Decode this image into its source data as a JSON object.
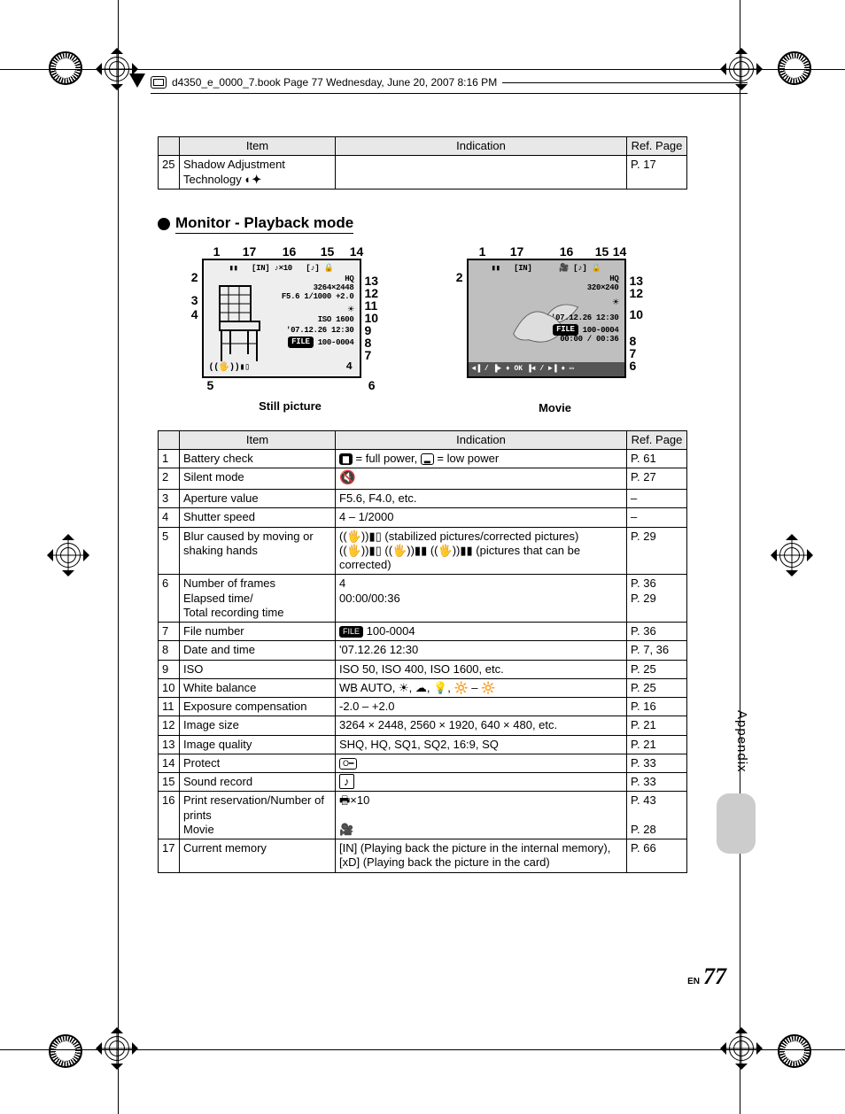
{
  "header_line": "d4350_e_0000_7.book  Page 77  Wednesday, June 20, 2007  8:16 PM",
  "top_table": {
    "headers": [
      "",
      "Item",
      "Indication",
      "Ref. Page"
    ],
    "row": {
      "num": "25",
      "item": "Shadow Adjustment Technology",
      "indication_icon": "shadow-adj-icon",
      "ref": "P. 17"
    }
  },
  "heading": "Monitor - Playback mode",
  "diagram_left": {
    "top_numbers": [
      "1",
      "17",
      "16",
      "15",
      "14"
    ],
    "left_numbers": [
      "2",
      "3",
      "4"
    ],
    "right_numbers": [
      "13",
      "12",
      "11",
      "10",
      "9",
      "8",
      "7"
    ],
    "bottom_numbers": [
      "5",
      "6"
    ],
    "screen_lines": {
      "l1": "[IN] ♪×10",
      "l2": "HQ",
      "l3": "3264×2448",
      "l4": "F5.6 1/1000 +2.0",
      "l5": "☀",
      "l6": "ISO 1600",
      "l7": "'07.12.26 12:30",
      "l8": "FILE 100-0004",
      "l9": "4"
    },
    "label": "Still picture"
  },
  "diagram_right": {
    "top_numbers": [
      "1",
      "17",
      "16",
      "15",
      "14"
    ],
    "left_numbers": [
      "2"
    ],
    "right_numbers": [
      "13",
      "12",
      "10",
      "8",
      "7",
      "6"
    ],
    "screen_lines": {
      "l1": "[IN]",
      "l2": "HQ",
      "l3": "320×240",
      "l4": "☀",
      "l5": "'07.12.26 12:30",
      "l6": "FILE 100-0004",
      "l7": "00:00 / 00:36",
      "l8": "◄▐ / ▐► ♦ OK      ▐◄ / ►▐ ♦ ▭"
    },
    "label": "Movie"
  },
  "main_table": {
    "headers": [
      "",
      "Item",
      "Indication",
      "Ref. Page"
    ],
    "rows": [
      {
        "n": "1",
        "item": "Battery check",
        "ind": "🔳 = full power, 🔲 = low power",
        "ref": "P. 61"
      },
      {
        "n": "2",
        "item": "Silent mode",
        "ind": "🔇",
        "ref": "P. 27"
      },
      {
        "n": "3",
        "item": "Aperture value",
        "ind": "F5.6, F4.0, etc.",
        "ref": "–"
      },
      {
        "n": "4",
        "item": "Shutter speed",
        "ind": "4 – 1/2000",
        "ref": "–"
      },
      {
        "n": "5",
        "item": "Blur caused by moving or shaking hands",
        "ind": "(stabilized pictures/corrected pictures)\n(pictures that can be corrected)",
        "ref": "P. 29"
      },
      {
        "n": "6",
        "item": "Number of frames\nElapsed time/\nTotal recording time",
        "ind": "4\n00:00/00:36",
        "ref": "P. 36\nP. 29"
      },
      {
        "n": "7",
        "item": "File number",
        "ind": "FILE 100-0004",
        "ref": "P. 36"
      },
      {
        "n": "8",
        "item": "Date and time",
        "ind": "'07.12.26 12:30",
        "ref": "P. 7, 36"
      },
      {
        "n": "9",
        "item": "ISO",
        "ind": "ISO 50, ISO 400, ISO 1600, etc.",
        "ref": "P. 25"
      },
      {
        "n": "10",
        "item": "White balance",
        "ind": "WB AUTO, ☀, ☁, 💡, 🌅 – 🔆",
        "ref": "P. 25"
      },
      {
        "n": "11",
        "item": "Exposure compensation",
        "ind": "-2.0 – +2.0",
        "ref": "P. 16"
      },
      {
        "n": "12",
        "item": "Image size",
        "ind": "3264 × 2448, 2560 × 1920, 640 × 480, etc.",
        "ref": "P. 21"
      },
      {
        "n": "13",
        "item": "Image quality",
        "ind": "SHQ, HQ, SQ1, SQ2, 16:9, SQ",
        "ref": "P. 21"
      },
      {
        "n": "14",
        "item": "Protect",
        "ind": "🔒",
        "ref": "P. 33"
      },
      {
        "n": "15",
        "item": "Sound record",
        "ind": "[♪]",
        "ref": "P. 33"
      },
      {
        "n": "16",
        "item": "Print reservation/Number of prints\nMovie",
        "ind": "🖶×10\n🎥",
        "ref": "P. 43\n\nP. 28"
      },
      {
        "n": "17",
        "item": "Current memory",
        "ind": "[IN] (Playing back the picture in the internal memory), [xD] (Playing back the picture in the card)",
        "ref": "P. 66"
      }
    ]
  },
  "side_tab": "Appendix",
  "footer": {
    "lang": "EN",
    "page": "77"
  }
}
